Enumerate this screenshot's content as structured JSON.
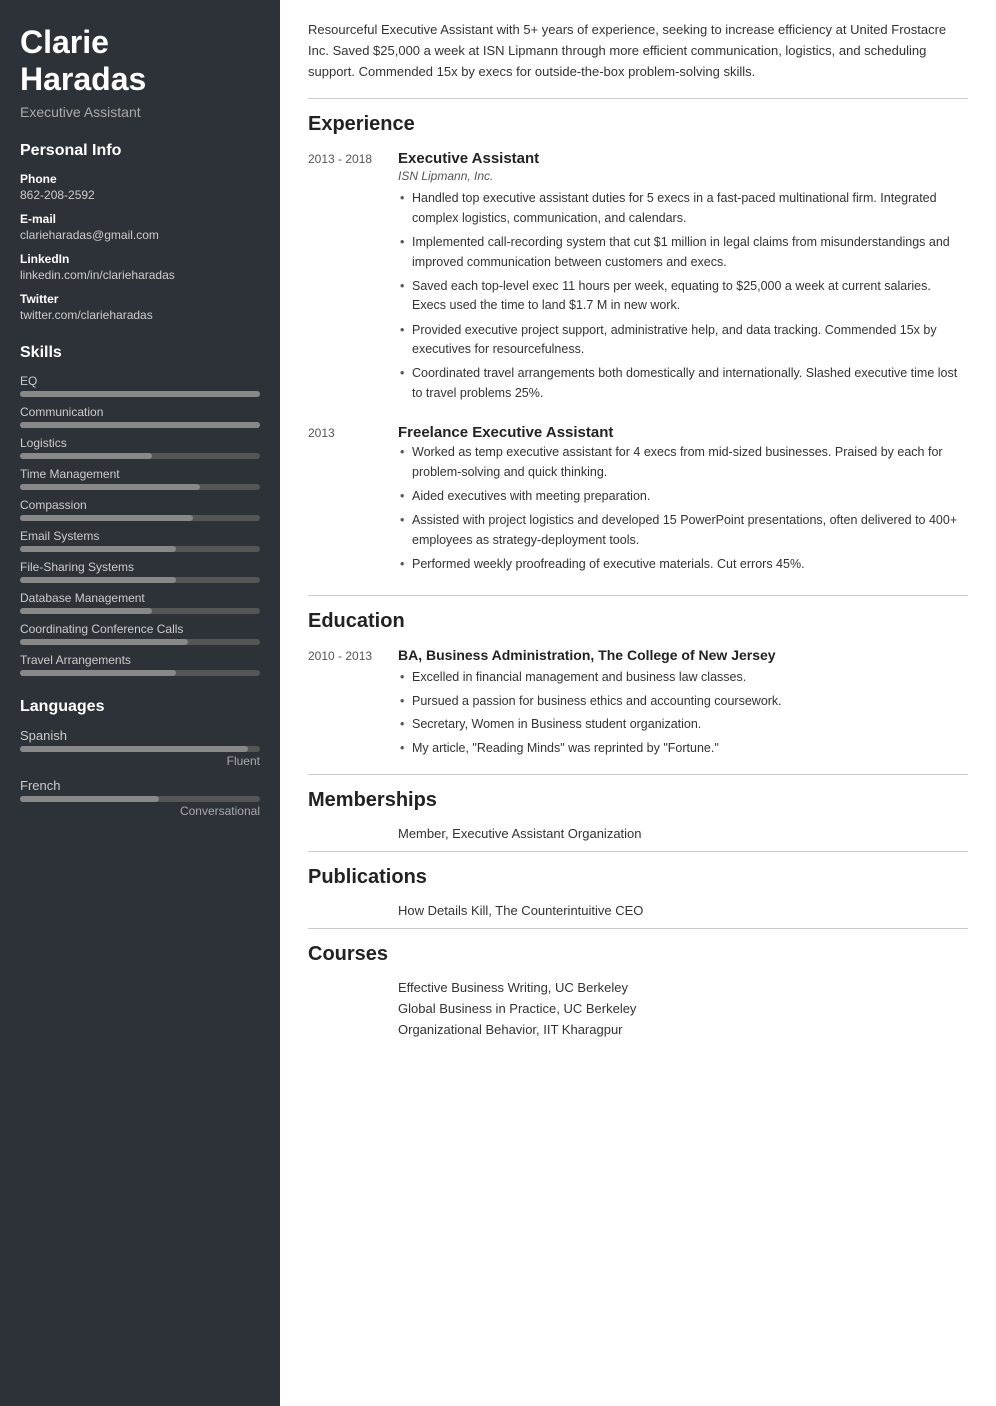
{
  "sidebar": {
    "name_line1": "Clarie",
    "name_line2": "Haradas",
    "title": "Executive Assistant",
    "personal_info_heading": "Personal Info",
    "phone_label": "Phone",
    "phone_value": "862-208-2592",
    "email_label": "E-mail",
    "email_value": "clarieharadas@gmail.com",
    "linkedin_label": "LinkedIn",
    "linkedin_value": "linkedin.com/in/clarieharadas",
    "twitter_label": "Twitter",
    "twitter_value": "twitter.com/clarieharadas",
    "skills_heading": "Skills",
    "skills": [
      {
        "name": "EQ",
        "pct": 100
      },
      {
        "name": "Communication",
        "pct": 100
      },
      {
        "name": "Logistics",
        "pct": 55
      },
      {
        "name": "Time Management",
        "pct": 75
      },
      {
        "name": "Compassion",
        "pct": 72
      },
      {
        "name": "Email Systems",
        "pct": 65
      },
      {
        "name": "File-Sharing Systems",
        "pct": 65
      },
      {
        "name": "Database Management",
        "pct": 55
      },
      {
        "name": "Coordinating Conference Calls",
        "pct": 70
      },
      {
        "name": "Travel Arrangements",
        "pct": 65
      }
    ],
    "languages_heading": "Languages",
    "languages": [
      {
        "name": "Spanish",
        "pct": 95,
        "level": "Fluent"
      },
      {
        "name": "French",
        "pct": 58,
        "level": "Conversational"
      }
    ]
  },
  "main": {
    "summary": "Resourceful Executive Assistant with 5+ years of experience, seeking to increase efficiency at United Frostacre Inc. Saved $25,000 a week at ISN Lipmann through more efficient communication, logistics, and scheduling support. Commended 15x by execs for outside-the-box problem-solving skills.",
    "experience_heading": "Experience",
    "jobs": [
      {
        "dates": "2013 - 2018",
        "title": "Executive Assistant",
        "company": "ISN Lipmann, Inc.",
        "bullets": [
          "Handled top executive assistant duties for 5 execs in a fast-paced multinational firm. Integrated complex logistics, communication, and calendars.",
          "Implemented call-recording system that cut $1 million in legal claims from misunderstandings and improved communication between customers and execs.",
          "Saved each top-level exec 11 hours per week, equating to $25,000 a week at current salaries. Execs used the time to land $1.7 M in new work.",
          "Provided executive project support, administrative help, and data tracking. Commended 15x by executives for resourcefulness.",
          "Coordinated travel arrangements both domestically and internationally. Slashed executive time lost to travel problems 25%."
        ]
      },
      {
        "dates": "2013",
        "title": "Freelance Executive Assistant",
        "company": "",
        "bullets": [
          "Worked as temp executive assistant for 4 execs from mid-sized businesses. Praised by each for problem-solving and quick thinking.",
          "Aided executives with meeting preparation.",
          "Assisted with project logistics and developed 15 PowerPoint presentations, often delivered to 400+ employees as strategy-deployment tools.",
          "Performed weekly proofreading of executive materials. Cut errors 45%."
        ]
      }
    ],
    "education_heading": "Education",
    "education": [
      {
        "dates": "2010 - 2013",
        "degree": "BA, Business Administration, The College of New Jersey",
        "bullets": [
          "Excelled in financial management and business law classes.",
          "Pursued a passion for business ethics and accounting coursework.",
          "Secretary, Women in Business student organization.",
          "My article, \"Reading Minds\" was reprinted by \"Fortune.\""
        ]
      }
    ],
    "memberships_heading": "Memberships",
    "memberships": [
      "Member, Executive Assistant Organization"
    ],
    "publications_heading": "Publications",
    "publications": [
      "How Details Kill, The Counterintuitive CEO"
    ],
    "courses_heading": "Courses",
    "courses": [
      "Effective Business Writing, UC Berkeley",
      "Global Business in Practice, UC Berkeley",
      "Organizational Behavior, IIT Kharagpur"
    ]
  }
}
